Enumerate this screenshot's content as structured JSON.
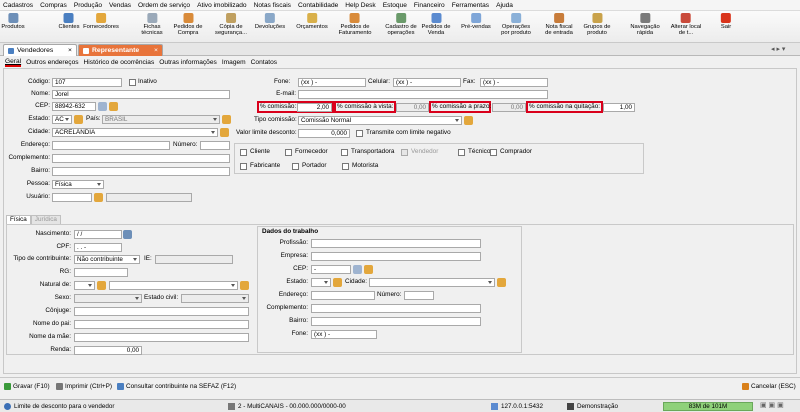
{
  "menu": [
    "Cadastros",
    "Compras",
    "Produção",
    "Vendas",
    "Ordem de serviço",
    "Ativo imobilizado",
    "Notas fiscais",
    "Contabilidade",
    "Help Desk",
    "Estoque",
    "Financeiro",
    "Ferramentas",
    "Ajuda"
  ],
  "toolbar": [
    {
      "label": "Produtos",
      "icon": "box-icon"
    },
    {
      "label": "Clientes",
      "icon": "users-icon"
    },
    {
      "label": "Fornecedores",
      "icon": "truck-icon"
    },
    {
      "label": "Fichas\ntécnicas",
      "icon": "sheet-icon"
    },
    {
      "label": "Pedidos de\nCompra",
      "icon": "cart-icon"
    },
    {
      "label": "Cópia de\nsegurança...",
      "icon": "backup-icon"
    },
    {
      "label": "Devoluções",
      "icon": "return-icon"
    },
    {
      "label": "Orçamentos",
      "icon": "quote-icon"
    },
    {
      "label": "Pedidos de\nFaturamento",
      "icon": "invoice-icon"
    },
    {
      "label": "Cadastro de\noperações",
      "icon": "ops-icon"
    },
    {
      "label": "Pedidos de\nVenda",
      "icon": "sale-icon"
    },
    {
      "label": "Pré-vendas",
      "icon": "presale-icon"
    },
    {
      "label": "Operações\npor produto",
      "icon": "chart-icon"
    },
    {
      "label": "Nota fiscal\nde entrada",
      "icon": "nf-icon"
    },
    {
      "label": "Grupos de\nproduto",
      "icon": "groups-icon"
    },
    {
      "label": "Navegação\nrápida",
      "icon": "nav-icon"
    },
    {
      "label": "Alterar local\nde t...",
      "icon": "home-icon"
    },
    {
      "label": "Sair",
      "icon": "exit-icon"
    }
  ],
  "tabs": {
    "vendedores": "Vendedores",
    "representante": "Representante",
    "close": "×"
  },
  "subtabs": [
    "Geral",
    "Outros endereços",
    "Histórico de ocorrências",
    "Outras informações",
    "Imagem",
    "Contatos"
  ],
  "left": {
    "codigo_label": "Código:",
    "codigo": "107",
    "inativo_label": "Inativo",
    "nome_label": "Nome:",
    "nome": "Jorel",
    "cep_label": "CEP:",
    "cep": "88942-632",
    "estado_label": "Estado:",
    "estado": "AC",
    "pais_label": "País:",
    "pais": "BRASIL",
    "cidade_label": "Cidade:",
    "cidade": "ACRELÂNDIA",
    "endereco_label": "Endereço:",
    "numero_label": "Número:",
    "complemento_label": "Complemento:",
    "bairro_label": "Bairro:",
    "pessoa_label": "Pessoa:",
    "pessoa": "Física",
    "usuario_label": "Usuário:"
  },
  "right": {
    "fone_label": "Fone:",
    "fone": "(xx )   -",
    "celular_label": "Celular:",
    "celular": "(xx )   -",
    "fax_label": "Fax:",
    "fax": "(xx )   -",
    "email_label": "E-mail:",
    "comissao_label": "% comissão:",
    "comissao": "2,00",
    "avista_label": "% comissão à vista:",
    "avista": "0,00",
    "aprazo_label": "% comissão a prazo:",
    "aprazo": "0,00",
    "quitacao_label": "% comissão na quitação:",
    "quitacao": "1,00",
    "tipo_label": "Tipo comissão:",
    "tipo": "Comissão Normal",
    "limite_label": "Valor limite desconto:",
    "limite": "0,000",
    "transmite_label": "Transmite com limite negativo",
    "checks": [
      "Cliente",
      "Fornecedor",
      "Transportadora",
      "Vendedor",
      "Técnico",
      "Comprador",
      "Fabricante",
      "Portador",
      "Motorista"
    ]
  },
  "fisica": {
    "tab_fisica": "Física",
    "tab_juridica": "Jurídica",
    "nascimento_label": "Nascimento:",
    "nascimento": " / /",
    "cpf_label": "CPF:",
    "cpf": "  .   .   -",
    "tipo_contrib_label": "Tipo de contribuinte:",
    "tipo_contrib": "Não contribuinte",
    "ie_label": "IE:",
    "rg_label": "RG:",
    "natural_label": "Natural de:",
    "sexo_label": "Sexo:",
    "estado_civil_label": "Estado civil:",
    "conjuge_label": "Cônjuge:",
    "pai_label": "Nome do pai:",
    "mae_label": "Nome da mãe:",
    "renda_label": "Renda:",
    "renda": "0,00"
  },
  "trabalho": {
    "title": "Dados do trabalho",
    "profissao_label": "Profissão:",
    "empresa_label": "Empresa:",
    "cep_label": "CEP:",
    "cep": "   -",
    "estado_label": "Estado:",
    "cidade_label": "Cidade:",
    "endereco_label": "Endereço:",
    "numero_label": "Número:",
    "complemento_label": "Complemento:",
    "bairro_label": "Bairro:",
    "fone_label": "Fone:",
    "fone": "(xx )   -"
  },
  "bottom": {
    "gravar": "Gravar (F10)",
    "imprimir": "Imprimir (Ctrl+P)",
    "consultar": "Consultar contribuinte na SEFAZ (F12)",
    "cancelar": "Cancelar (ESC)"
  },
  "status": {
    "hint": "Limite de desconto para o vendedor",
    "empresa": "2 - MultiCANAIS - 00.000.000/0000-00",
    "ip": "127.0.0.1:5432",
    "modo": "Demonstração",
    "mem": "83M de 101M"
  },
  "colors": {
    "accent": "#e8743b",
    "highlight": "#d9001b",
    "memory": "#8fd17a"
  }
}
